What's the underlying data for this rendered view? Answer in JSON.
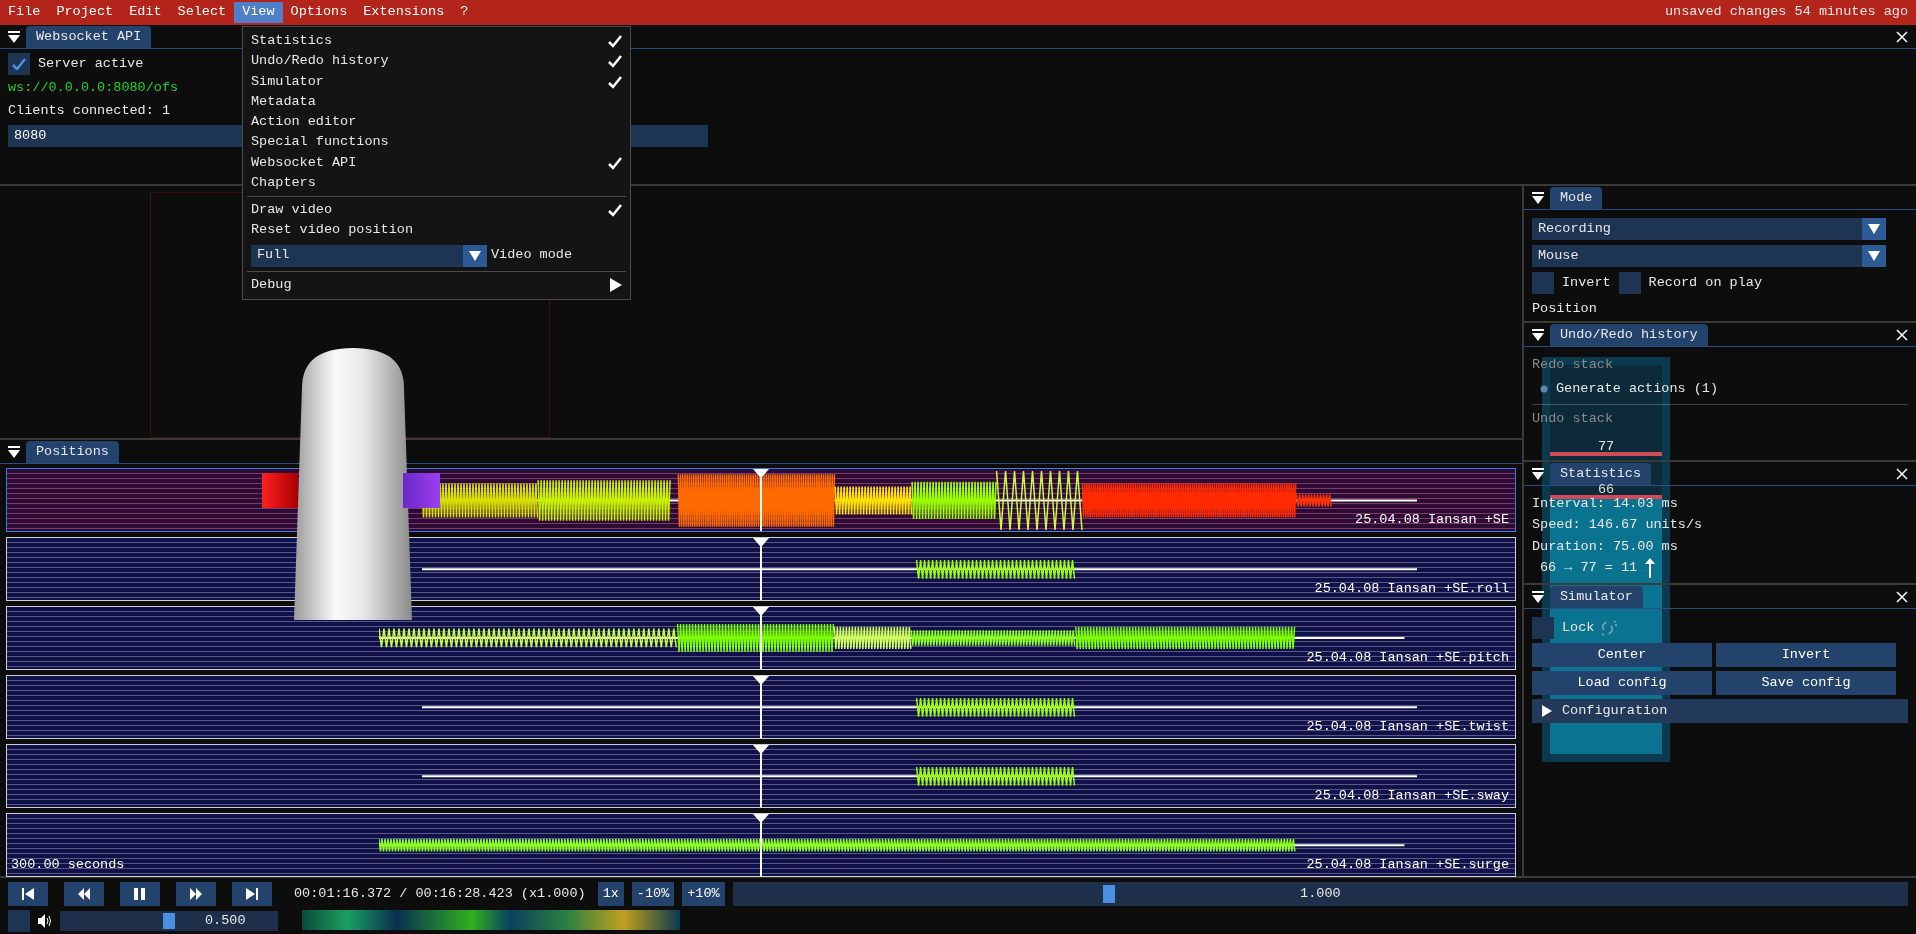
{
  "menu_bar": {
    "items": [
      {
        "label": "File",
        "selected": false
      },
      {
        "label": "Project",
        "selected": false
      },
      {
        "label": "Edit",
        "selected": false
      },
      {
        "label": "Select",
        "selected": false
      },
      {
        "label": "View",
        "selected": true
      },
      {
        "label": "Options",
        "selected": false
      },
      {
        "label": "Extensions",
        "selected": false
      },
      {
        "label": "?",
        "selected": false
      }
    ],
    "status": "unsaved changes 54 minutes ago"
  },
  "view_menu": {
    "items": [
      {
        "kind": "toggle",
        "label": "Statistics",
        "checked": true
      },
      {
        "kind": "toggle",
        "label": "Undo/Redo history",
        "checked": true
      },
      {
        "kind": "toggle",
        "label": "Simulator",
        "checked": true
      },
      {
        "kind": "toggle",
        "label": "Metadata",
        "checked": false
      },
      {
        "kind": "toggle",
        "label": "Action editor",
        "checked": false
      },
      {
        "kind": "toggle",
        "label": "Special functions",
        "checked": false
      },
      {
        "kind": "toggle",
        "label": "Websocket API",
        "checked": true
      },
      {
        "kind": "toggle",
        "label": "Chapters",
        "checked": false
      },
      {
        "kind": "separator"
      },
      {
        "kind": "toggle",
        "label": "Draw video",
        "checked": true
      },
      {
        "kind": "action",
        "label": "Reset video position"
      },
      {
        "kind": "combo",
        "label": "Video mode",
        "current": "Full"
      },
      {
        "kind": "separator"
      },
      {
        "kind": "submenu",
        "label": "Debug"
      }
    ]
  },
  "websocket_panel": {
    "title": "Websocket API",
    "closable": true,
    "server_active": {
      "label": "Server active",
      "checked": true
    },
    "url": "ws://0.0.0.0:8080/ofs",
    "clients": "Clients connected: 1",
    "port": "8080"
  },
  "positions_panel": {
    "title": "Positions",
    "closable": false,
    "tracks": [
      {
        "label": "25.04.08 Iansan +SE",
        "selected": true
      },
      {
        "label": "25.04.08 Iansan +SE.roll",
        "selected": false
      },
      {
        "label": "25.04.08 Iansan +SE.pitch",
        "selected": false
      },
      {
        "label": "25.04.08 Iansan +SE.twist",
        "selected": false
      },
      {
        "label": "25.04.08 Iansan +SE.sway",
        "selected": false
      },
      {
        "label": "25.04.08 Iansan +SE.surge",
        "selected": false
      }
    ],
    "time_span": "300.00 seconds"
  },
  "mode_panel": {
    "title": "Mode",
    "closable": false,
    "mode": "Recording",
    "input": "Mouse",
    "options": [
      {
        "label": "Invert",
        "checked": false
      },
      {
        "label": "Record on play",
        "checked": false
      }
    ],
    "section": "Position"
  },
  "history_panel": {
    "title": "Undo/Redo history",
    "closable": true,
    "redo_heading": "Redo stack",
    "redo_items": [
      "Generate actions (1)"
    ],
    "undo_heading": "Undo stack"
  },
  "statistics_panel": {
    "title": "Statistics",
    "closable": true,
    "lines": [
      "Interval: 14.03 ms",
      "Speed: 146.67 units/s",
      "Duration: 75.00 ms"
    ],
    "change": "66 → 77 =  11"
  },
  "simulator_panel": {
    "title": "Simulator",
    "closable": true,
    "lock": {
      "label": "Lock",
      "checked": false
    },
    "buttons": [
      "Center",
      "Invert",
      "Load config",
      "Save config"
    ],
    "section": "Configuration"
  },
  "simulator_bar": {
    "level": 0.66,
    "markers": [
      {
        "label": "77",
        "level": 0.77
      },
      {
        "label": "66",
        "level": 0.66
      }
    ]
  },
  "transport": {
    "time": "00:01:16.372 / 00:16:28.423 (x1.000)",
    "speed_buttons": [
      "1x",
      "-10%",
      "+10%"
    ],
    "speed": {
      "level": 0.32,
      "reading": "1.000"
    },
    "volume": {
      "level": 0.5,
      "reading": "0.500"
    }
  }
}
